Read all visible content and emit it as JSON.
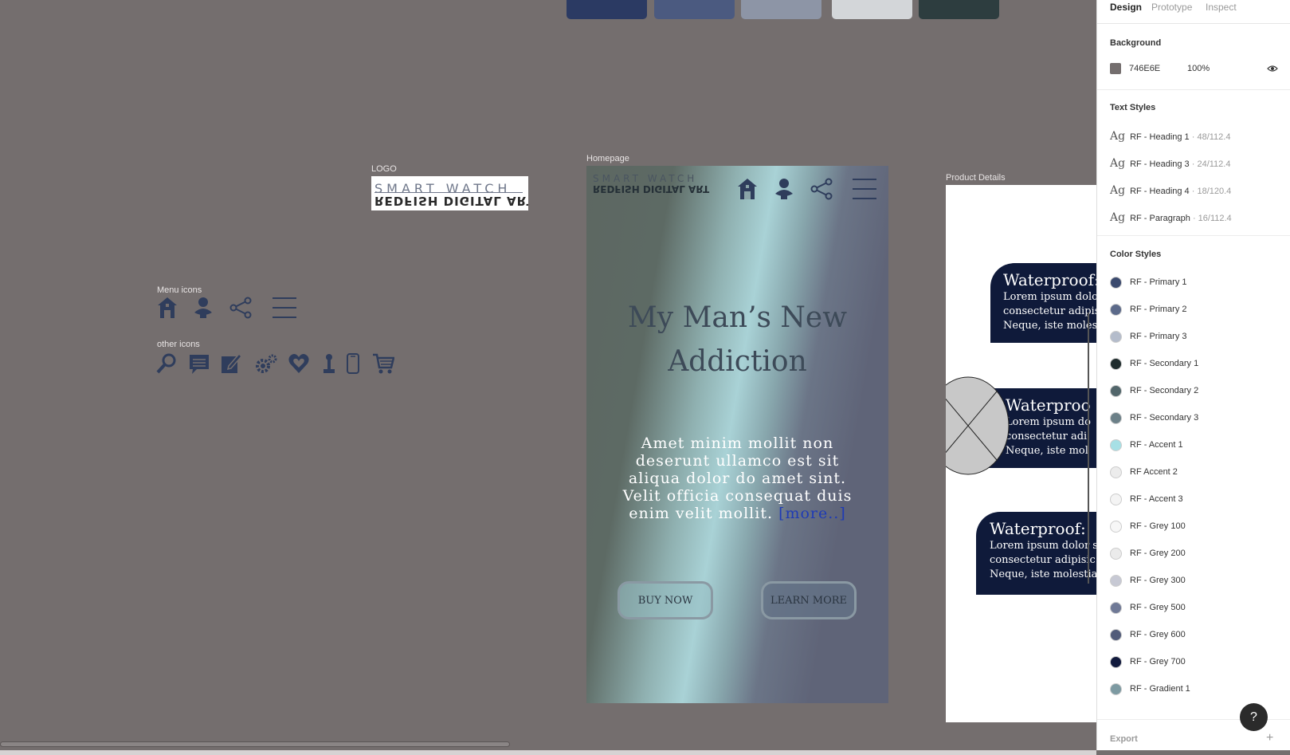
{
  "top_swatches": [
    {
      "name": "swatch-1",
      "color": "#2b3a63"
    },
    {
      "name": "swatch-2",
      "color": "#4b5a80"
    },
    {
      "name": "swatch-3",
      "color": "#8d95a6"
    },
    {
      "name": "swatch-4",
      "color": "#d3d6d9"
    },
    {
      "name": "swatch-5",
      "color": "#2d3d3f"
    }
  ],
  "canvas": {
    "logo_label": "LOGO",
    "logo_top_text": "SMART WATCH",
    "logo_bottom_text": "REDFISH DIGITAL ART",
    "menu_icons_label": "Menu icons",
    "other_icons_label": "other icons",
    "menu_icons": [
      "home-icon",
      "person-icon",
      "share-icon",
      "hamburger-icon"
    ],
    "other_icons": [
      "search-icon",
      "chat-icon",
      "edit-icon",
      "settings-icon",
      "heart-icon",
      "pin-icon",
      "phone-icon",
      "cart-icon"
    ],
    "icon_color": "#2f3d5c"
  },
  "homepage": {
    "label": "Homepage",
    "logo_top": "SMART WATCH",
    "logo_bottom": "REDFISH DIGITAL ART",
    "heading_line1": "My Man’s New",
    "heading_line2": "Addiction",
    "paragraph": "Amet minim mollit non deserunt ullamco est sit aliqua dolor do amet sint. Velit officia consequat duis enim velit mollit.",
    "more_link": "[more..]",
    "buy_button": "BUY NOW",
    "learn_button": "LEARN  MORE"
  },
  "product": {
    "label": "Product Details",
    "cards": [
      {
        "title": "Waterproof:",
        "line1": "Lorem ipsum dolo",
        "line2": "consectetur adipis",
        "line3": "Neque, iste molest"
      },
      {
        "title": "Waterproo",
        "line1": "Lorem ipsum do",
        "line2": "consectetur adi",
        "line3": "Neque, iste mol"
      },
      {
        "title": "Waterproof:",
        "line1": "Lorem ipsum dolor s",
        "line2": "consectetur adipisic",
        "line3": "Neque, iste molestia"
      }
    ]
  },
  "panel": {
    "tabs": [
      "Design",
      "Prototype",
      "Inspect"
    ],
    "background_title": "Background",
    "background_hex": "746E6E",
    "background_opacity": "100%",
    "text_styles_title": "Text Styles",
    "text_styles": [
      {
        "ag": "Ag",
        "name": "RF - Heading 1",
        "meta": "· 48/112.4"
      },
      {
        "ag": "Ag",
        "name": "RF - Heading 3",
        "meta": "· 24/112.4"
      },
      {
        "ag": "Ag",
        "name": "RF - Heading 4",
        "meta": "· 18/120.4"
      },
      {
        "ag": "Ag",
        "name": "RF - Paragraph",
        "meta": "· 16/112.4"
      }
    ],
    "color_styles_title": "Color Styles",
    "color_styles": [
      {
        "name": "RF - Primary 1",
        "color": "#3b4a6e"
      },
      {
        "name": "RF - Primary 2",
        "color": "#5c6a8a"
      },
      {
        "name": "RF - Primary 3",
        "color": "#b4bccb"
      },
      {
        "name": "RF - Secondary 1",
        "color": "#1f2c2d"
      },
      {
        "name": "RF - Secondary 2",
        "color": "#52666b"
      },
      {
        "name": "RF - Secondary 3",
        "color": "#6c8088"
      },
      {
        "name": "RF - Accent 1",
        "color": "#a7e0e5"
      },
      {
        "name": "RF Accent 2",
        "color": "#ececec"
      },
      {
        "name": "RF - Accent 3",
        "color": "#f4f4f4"
      },
      {
        "name": "RF - Grey 100",
        "color": "#f7f7f7"
      },
      {
        "name": "RF - Grey 200",
        "color": "#ebebeb"
      },
      {
        "name": "RF - Grey 300",
        "color": "#c7c9d4"
      },
      {
        "name": "RF - Grey 500",
        "color": "#6f7996"
      },
      {
        "name": "RF - Grey 600",
        "color": "#525c7a"
      },
      {
        "name": "RF - Grey 700",
        "color": "#111a3d"
      },
      {
        "name": "RF - Gradient 1",
        "color": "#7d9aa2"
      }
    ],
    "export_label": "Export",
    "help_label": "?"
  }
}
